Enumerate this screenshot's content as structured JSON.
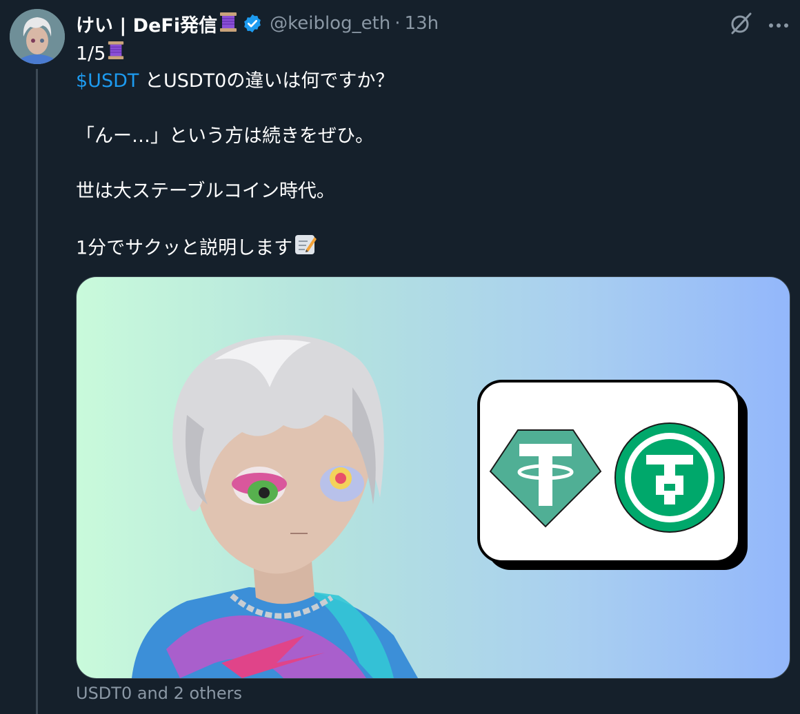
{
  "user": {
    "display_name": "けい | DeFi発信",
    "handle": "@keiblog_eth",
    "separator": "·",
    "time": "13h",
    "verified": true,
    "emoji": "thread-spool"
  },
  "tweet": {
    "lines": [
      {
        "text": "1/5",
        "emoji": "thread-spool"
      },
      {
        "cashtag": "$USDT",
        "text": " とUSDT0の違いは何ですか？"
      },
      {
        "text": ""
      },
      {
        "text": "「んー…」という方は続きをぜひ。"
      },
      {
        "text": ""
      },
      {
        "text": "世は大ステーブルコイン時代。"
      },
      {
        "text": ""
      },
      {
        "text": "1分でサクッと説明します",
        "emoji": "memo"
      }
    ]
  },
  "media": {
    "description_icons": [
      "tether-logo-icon",
      "usdt0-logo-icon"
    ],
    "gradient_colors": [
      "#c9fadb",
      "#93b7fb"
    ],
    "logo_color": "#50af95",
    "usdt0_color": "#00a86b"
  },
  "footer": {
    "tagged": "USDT0 and 2 others"
  },
  "colors": {
    "background": "#15202b",
    "accent": "#1d9bf0",
    "muted": "#8b98a5",
    "verified": "#1d9bf0"
  }
}
